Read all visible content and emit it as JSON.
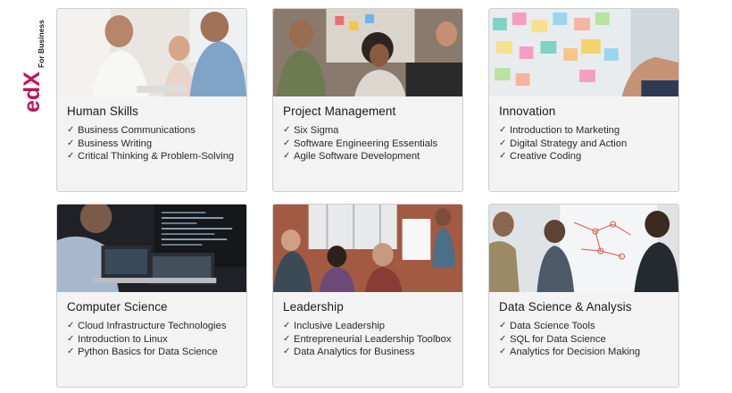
{
  "brand": {
    "logo_text": "edX",
    "logo_sub": "For Business"
  },
  "check_glyph": "✓",
  "cards": [
    {
      "title": "Human Skills",
      "photo": "people-meeting-image",
      "items": [
        "Business Communications",
        "Business Writing",
        "Critical Thinking & Problem-Solving"
      ]
    },
    {
      "title": "Project Management",
      "photo": "team-planning-image",
      "items": [
        "Six Sigma",
        "Software Engineering Essentials",
        "Agile Software Development"
      ]
    },
    {
      "title": "Innovation",
      "photo": "sticky-notes-image",
      "items": [
        "Introduction to Marketing",
        "Digital Strategy and Action",
        "Creative Coding"
      ]
    },
    {
      "title": "Computer Science",
      "photo": "laptop-code-image",
      "items": [
        "Cloud Infrastructure Technologies",
        "Introduction to Linux",
        "Python Basics for Data Science"
      ]
    },
    {
      "title": "Leadership",
      "photo": "presentation-image",
      "items": [
        "Inclusive Leadership",
        "Entrepreneurial Leadership Toolbox",
        "Data Analytics for Business"
      ]
    },
    {
      "title": "Data Science & Analysis",
      "photo": "whiteboard-diagram-image",
      "items": [
        "Data Science Tools",
        "SQL for Data Science",
        "Analytics for Decision Making"
      ]
    }
  ]
}
